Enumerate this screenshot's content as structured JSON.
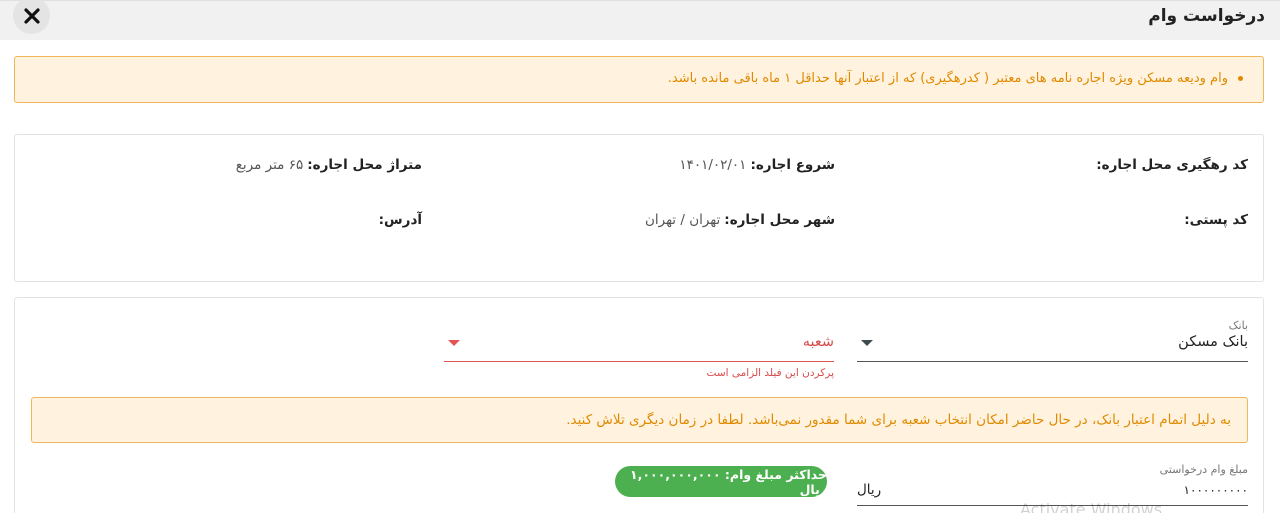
{
  "header": {
    "title": "درخواست وام"
  },
  "notice_rent": {
    "text": "وام ودیعه مسکن ویژه اجاره نامه های معتبر ( کدرهگیری) که از اعتبار آنها حداقل ۱ ماه باقی مانده باشد."
  },
  "rental_info": {
    "tracking_code_label": "کد رهگیری محل اجاره:",
    "tracking_code_value": "",
    "start_label": "شروع اجاره:",
    "start_value": "۱۴۰۱/۰۲/۰۱",
    "area_label": "متراژ محل اجاره:",
    "area_value": "۶۵ متر مربع",
    "postal_code_label": "کد پستی:",
    "postal_code_value": "",
    "city_label": "شهر محل اجاره:",
    "city_value": "تهران / تهران",
    "address_label": "آدرس:",
    "address_value": ""
  },
  "form": {
    "bank_label": "بانک",
    "bank_value": "بانک مسکن",
    "branch_placeholder": "شعبه",
    "branch_error": "پرکردن این فیلد الزامی است",
    "bank_notice": "به دلیل اتمام اعتبار بانک، در حال حاضر امکان انتخاب شعبه برای شما مقدور نمی‌باشد. لطفا در زمان دیگری تلاش کنید.",
    "amount_label": "مبلغ وام درخواستی",
    "amount_value": "۱۰۰۰۰۰۰۰۰۰",
    "amount_unit": "ریال",
    "max_amount_text": "حداکثر مبلغ وام: ۱,۰۰۰,۰۰۰,۰۰۰ ریال"
  },
  "watermark": "Activate Windows",
  "colors": {
    "notice_bg": "#fff3e0",
    "notice_border": "#f0b65a",
    "notice_text": "#e08a00",
    "error": "#d94b4b",
    "success_badge": "#4caf50"
  }
}
